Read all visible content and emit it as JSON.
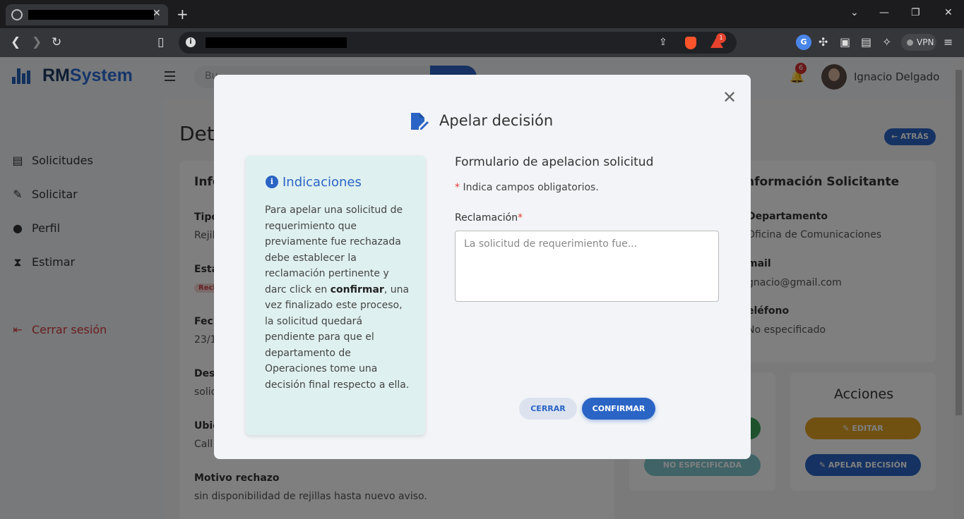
{
  "browser": {
    "new_tab_symbol": "+",
    "tab_close_symbol": "✕",
    "vpn_label": "VPN",
    "bat_badge": "1"
  },
  "app": {
    "brand_prefix": "RM",
    "brand_suffix": "System",
    "search_placeholder": "Bu",
    "notifications_count": "6",
    "user_name": "Ignacio Delgado"
  },
  "sidebar": {
    "items": [
      {
        "label": "Solicitudes",
        "icon": "clipboard-icon"
      },
      {
        "label": "Solicitar",
        "icon": "pencil-icon"
      },
      {
        "label": "Perfil",
        "icon": "user-icon"
      },
      {
        "label": "Estimar",
        "icon": "hourglass-icon"
      }
    ],
    "logout_label": "Cerrar sesión"
  },
  "page": {
    "title_fragment": "Det",
    "back_label": "← ATRÁS",
    "info_card_title_fragment": "Info",
    "fields_left": [
      {
        "label": "Tipo",
        "value": "Rejil"
      },
      {
        "label": "Esta",
        "value": "Rech"
      },
      {
        "label": "Fech",
        "value": "23/1"
      },
      {
        "label": "Desc",
        "value": "solic"
      },
      {
        "label": "Ubic",
        "value": "Call"
      }
    ],
    "motivo_label": "Motivo rechazo",
    "motivo_value": "sin disponibilidad de rejillas hasta nuevo aviso.",
    "requester_title": "nformación Solicitante",
    "requester_fields": [
      {
        "label": "Departamento",
        "value": "Oficina de Comunicaciones"
      },
      {
        "label": "mail",
        "value": "gnacio@gmail.com"
      },
      {
        "label": "eléfono",
        "value": "No especificado"
      }
    ],
    "actions_title": "Acciones",
    "edit_label": "EDITAR",
    "appeal_label": "APELAR DECISIÓN",
    "unspecified_label": "NO ESPECIFICADA"
  },
  "modal": {
    "title": "Apelar decisión",
    "indications_title": "Indicaciones",
    "indications_text_before": "Para apelar una solicitud de requerimiento que previamente fue rechazada debe establecer la reclamación pertinente y darc click en ",
    "indications_text_bold": "confirmar",
    "indications_text_after": ", una vez finalizado este proceso, la solicitud quedará pendiente para que el departamento de Operaciones tome una decisión final respecto a ella.",
    "form_title": "Formulario de apelacion solicitud",
    "required_star": "*",
    "required_note": " Indica campos obligatorios.",
    "field_label": "Reclamación",
    "field_placeholder": "La solicitud de requerimiento fue...",
    "field_value": "",
    "cancel_label": "CERRAR",
    "confirm_label": "CONFIRMAR"
  },
  "colors": {
    "primary": "#2a64c5",
    "danger": "#d23c3c",
    "edit_button": "#e0a325",
    "indications_bg": "#dff0f0"
  }
}
